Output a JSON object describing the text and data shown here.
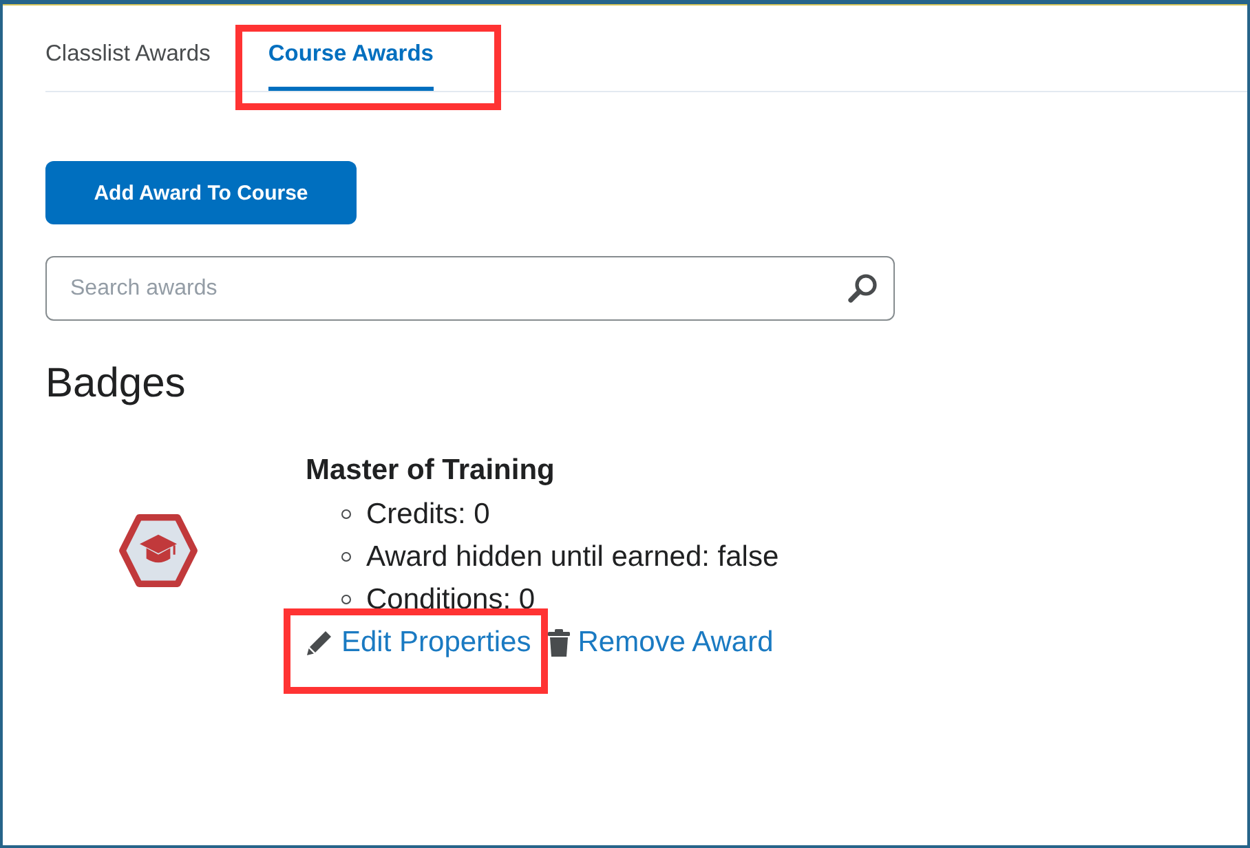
{
  "tabs": [
    {
      "label": "Classlist Awards",
      "selected": false,
      "highlighted": false
    },
    {
      "label": "Course Awards",
      "selected": true,
      "highlighted": true
    }
  ],
  "add_button": {
    "label": "Add Award To Course"
  },
  "search": {
    "placeholder": "Search awards"
  },
  "section_title": "Badges",
  "awards": [
    {
      "name": "Master of Training",
      "details": [
        "Credits: 0",
        "Award hidden until earned: false",
        "Conditions: 0"
      ],
      "actions": [
        {
          "kind": "edit",
          "label": "Edit Properties",
          "highlighted": true
        },
        {
          "kind": "remove",
          "label": "Remove Award",
          "highlighted": false
        }
      ]
    }
  ]
}
